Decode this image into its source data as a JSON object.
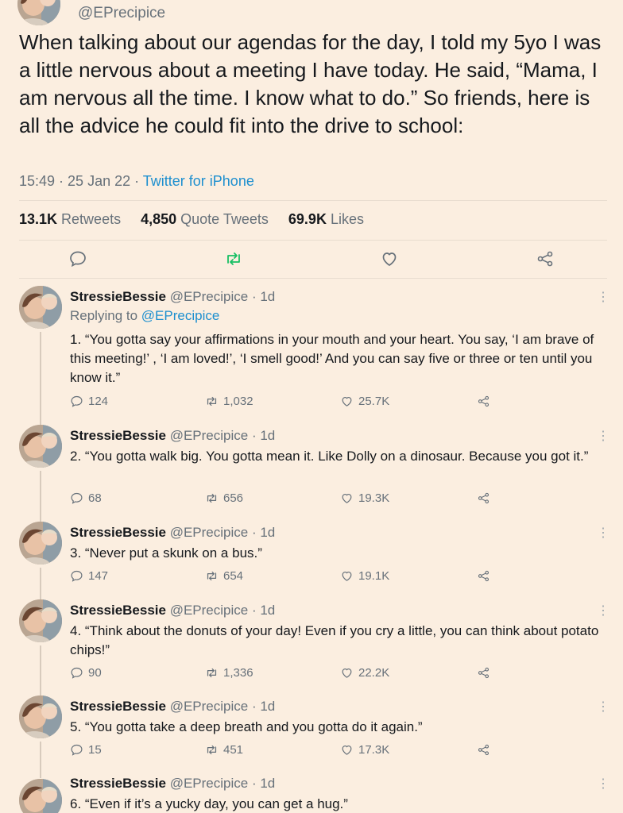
{
  "tweet": {
    "handle": "@EPrecipice",
    "text": "When talking about our agendas for the day, I told my 5yo I was a little nervous about a meeting I have today. He said, “Mama, I am nervous all the time. I know what to do.” So friends, here is all the advice he could fit into the drive to school:",
    "time": "15:49 · 25 Jan 22 · ",
    "source": "Twitter for iPhone",
    "stats": {
      "retweets_value": "13.1K",
      "retweets_label": " Retweets",
      "quotes_value": "4,850",
      "quotes_label": " Quote Tweets",
      "likes_value": "69.9K",
      "likes_label": " Likes"
    }
  },
  "icons": {
    "reply": "comment-icon",
    "retweet": "retweet-icon",
    "like": "heart-icon",
    "share": "share-icon",
    "more": "more-icon"
  },
  "colors": {
    "background": "#fbeee0",
    "link": "#1d8fcf",
    "retweet_active": "#17bf63",
    "secondary_text": "#67717a"
  },
  "replies": [
    {
      "name": "StressieBessie",
      "meta": " @EPrecipice · 1d",
      "replying_prefix": "Replying to ",
      "replying_mention": "@EPrecipice",
      "text": "1. “You gotta say your affirmations in your mouth and your heart. You say, ‘I am brave of this meeting!’ , ‘I am loved!’, ‘I smell good!’ And you can say five or three or ten until you know it.”",
      "replies": "124",
      "retweets": "1,032",
      "likes": "25.7K"
    },
    {
      "name": "StressieBessie",
      "meta": " @EPrecipice · 1d",
      "text": "2. “You gotta walk big. You gotta mean it. Like Dolly on a dinosaur. Because you got it.”",
      "replies": "68",
      "retweets": "656",
      "likes": "19.3K"
    },
    {
      "name": "StressieBessie",
      "meta": " @EPrecipice · 1d",
      "text": "3. “Never put a skunk on a bus.”",
      "replies": "147",
      "retweets": "654",
      "likes": "19.1K"
    },
    {
      "name": "StressieBessie",
      "meta": " @EPrecipice · 1d",
      "text": "4. “Think about the donuts of your day! Even if you cry a little, you can think about potato chips!”",
      "replies": "90",
      "retweets": "1,336",
      "likes": "22.2K"
    },
    {
      "name": "StressieBessie",
      "meta": " @EPrecipice · 1d",
      "text": "5. “You gotta take a deep breath and you gotta do it again.”",
      "replies": "15",
      "retweets": "451",
      "likes": "17.3K"
    },
    {
      "name": "StressieBessie",
      "meta": " @EPrecipice · 1d",
      "text": "6. “Even if it’s a yucky day, you can get a hug.”"
    }
  ]
}
